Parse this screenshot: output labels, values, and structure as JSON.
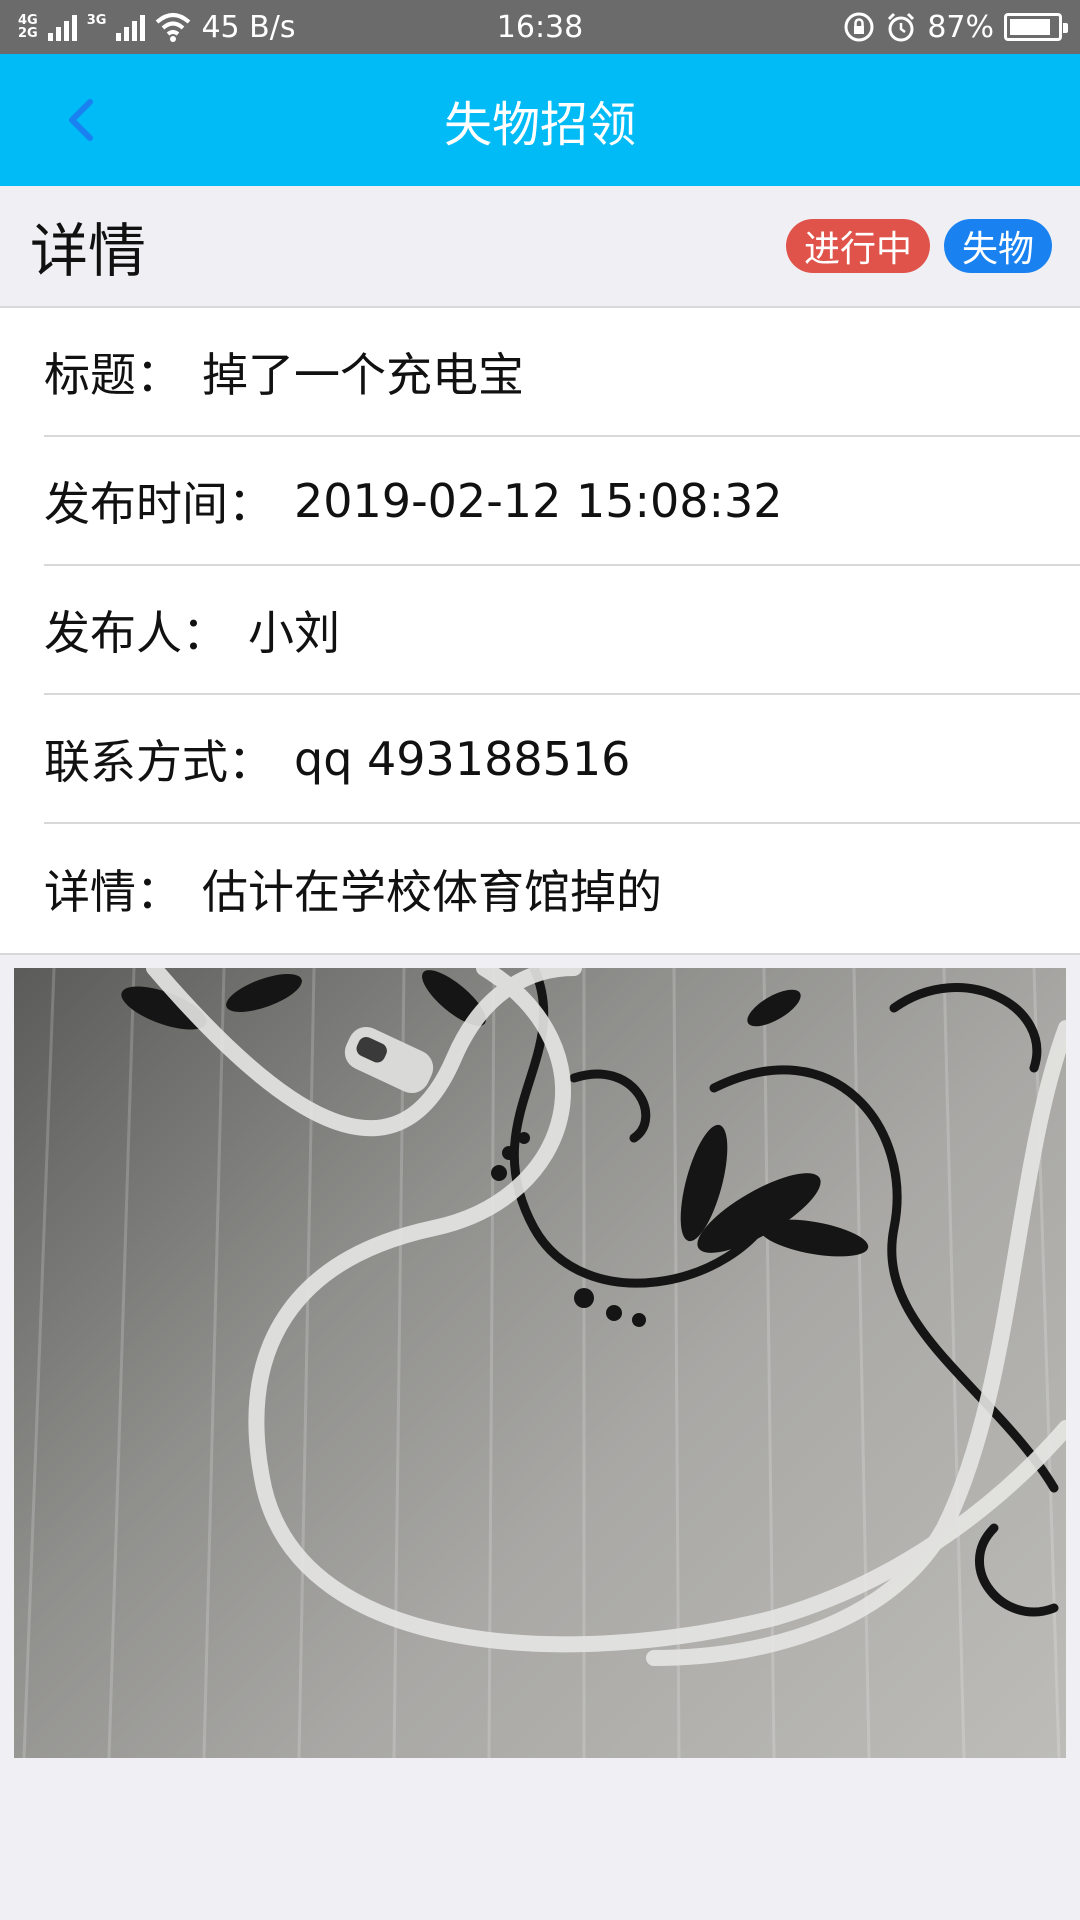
{
  "status_bar": {
    "network_top": "4G",
    "network_bottom": "2G",
    "network_secondary": "3G",
    "speed": "45 B/s",
    "time": "16:38",
    "battery": "87%",
    "battery_level": 0.87
  },
  "header": {
    "title": "失物招领",
    "back_icon": "chevron-left-icon"
  },
  "detail": {
    "section_title": "详情",
    "status_badge": "进行中",
    "type_badge": "失物",
    "rows": [
      {
        "label": "标题：",
        "value": "掉了一个充电宝"
      },
      {
        "label": "发布时间：",
        "value": "2019-02-12 15:08:32"
      },
      {
        "label": "发布人：",
        "value": "小刘"
      },
      {
        "label": "联系方式：",
        "value": "qq 493188516"
      },
      {
        "label": "详情：",
        "value": "估计在学校体育馆掉的"
      }
    ]
  },
  "colors": {
    "header": "#00bbf5",
    "back_icon": "#1a82f0",
    "status_badge": "#e0534a",
    "type_badge": "#1a82f0"
  }
}
